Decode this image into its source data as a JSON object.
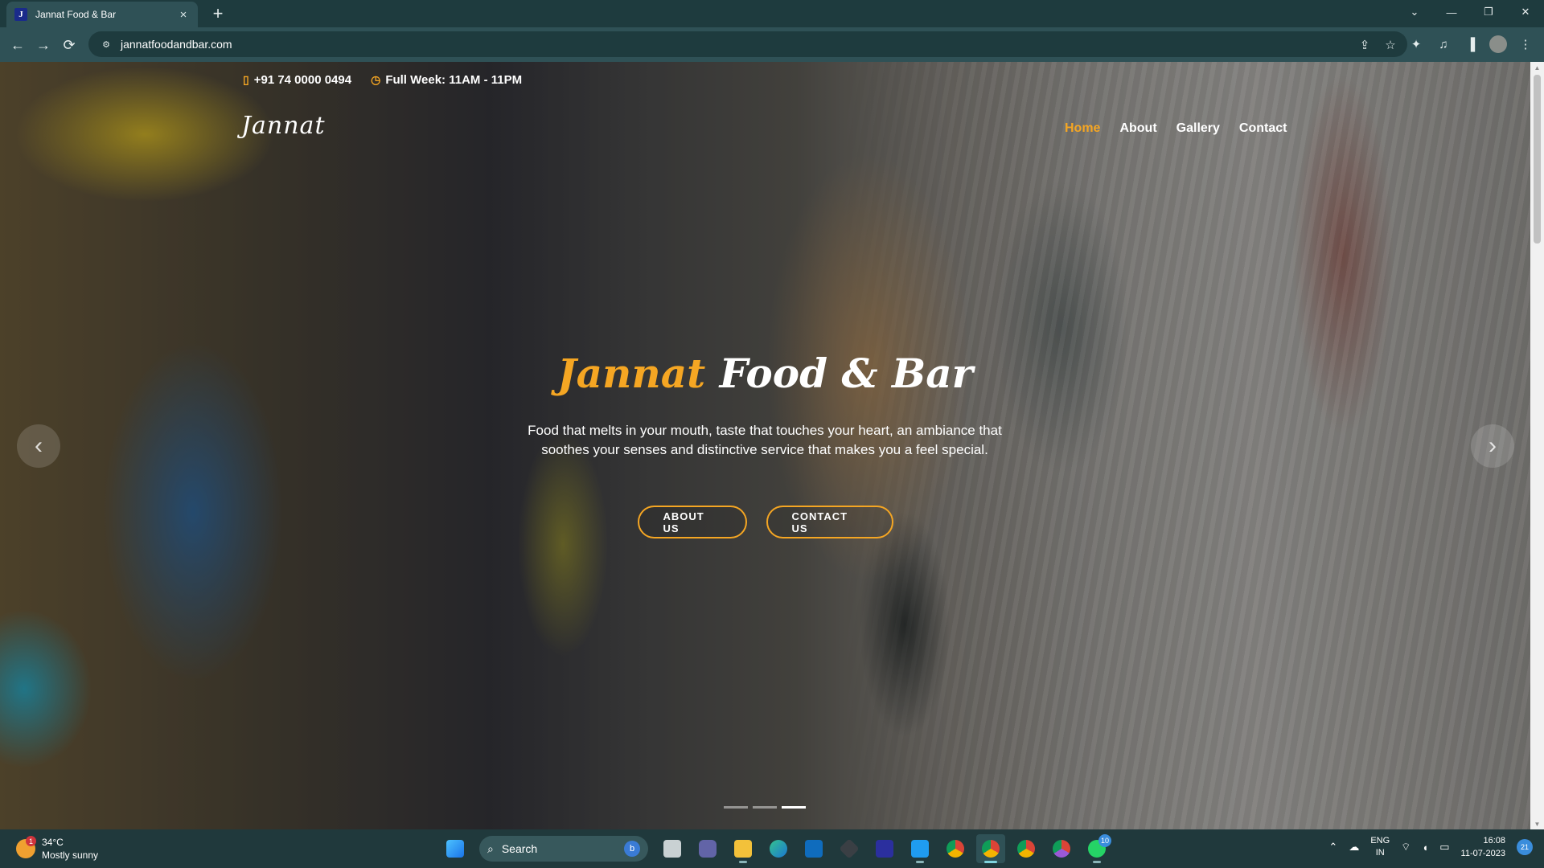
{
  "browser": {
    "tab": {
      "favicon": "J",
      "title": "Jannat Food & Bar",
      "close_icon": "×"
    },
    "new_tab_icon": "+",
    "window_controls": [
      "⌄",
      "—",
      "❐",
      "✕"
    ],
    "url": "jannatfoodandbar.com"
  },
  "site": {
    "phone": "+91 74 0000 0494",
    "hours": "Full Week: 11AM - 11PM",
    "logo": "Jannat",
    "nav": [
      {
        "label": "Home",
        "active": true
      },
      {
        "label": "About",
        "active": false
      },
      {
        "label": "Gallery",
        "active": false
      },
      {
        "label": "Contact",
        "active": false
      }
    ],
    "hero": {
      "title_accent": "Jannat",
      "title_rest": "Food & Bar",
      "description": "Food that melts in your mouth, taste that touches your heart, an ambiance that soothes your senses and distinctive service that makes you a feel special.",
      "about_button": "ABOUT US",
      "contact_button": "CONTACT US"
    },
    "carousel": {
      "prev_icon": "‹",
      "next_icon": "›",
      "slide_count": 3,
      "active_slide": 3
    },
    "colors": {
      "accent": "#f5a623"
    }
  },
  "taskbar": {
    "weather": {
      "temp": "34°C",
      "condition": "Mostly sunny",
      "badge": "1"
    },
    "search_label": "Search",
    "whatsapp_badge": "10",
    "tray": {
      "lang_top": "ENG",
      "lang_bottom": "IN",
      "time": "16:08",
      "date": "11-07-2023",
      "notifications": "21"
    }
  }
}
